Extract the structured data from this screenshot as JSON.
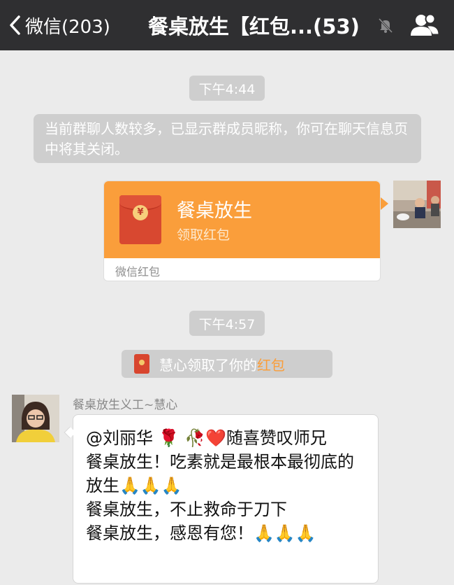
{
  "navbar": {
    "back_label": "微信(203)",
    "title": "餐桌放生【红包...(53)",
    "mute_icon": "mute-bell-icon",
    "members_icon": "group-members-icon"
  },
  "timestamps": [
    "下午4:44",
    "下午4:57"
  ],
  "system_notice": "当前群聊人数较多，已显示群成员昵称，你可在聊天信息页中将其关闭。",
  "red_packet": {
    "title": "餐桌放生",
    "subtitle": "领取红包",
    "footer": "微信红包",
    "seal_symbol": "¥",
    "color": "#fa9e3b"
  },
  "claim_notice": {
    "text": "慧心领取了你的",
    "highlight": "红包",
    "highlight_color": "#fa9e3b"
  },
  "incoming_message": {
    "sender": "餐桌放生义工~慧心",
    "text": "@刘丽华 🌹 🥀❤️随喜赞叹师兄\n餐桌放生！吃素就是最根本最彻底的放生🙏🙏🙏\n餐桌放生，不止救命于刀下\n餐桌放生，感恩有您！🙏🙏🙏"
  }
}
